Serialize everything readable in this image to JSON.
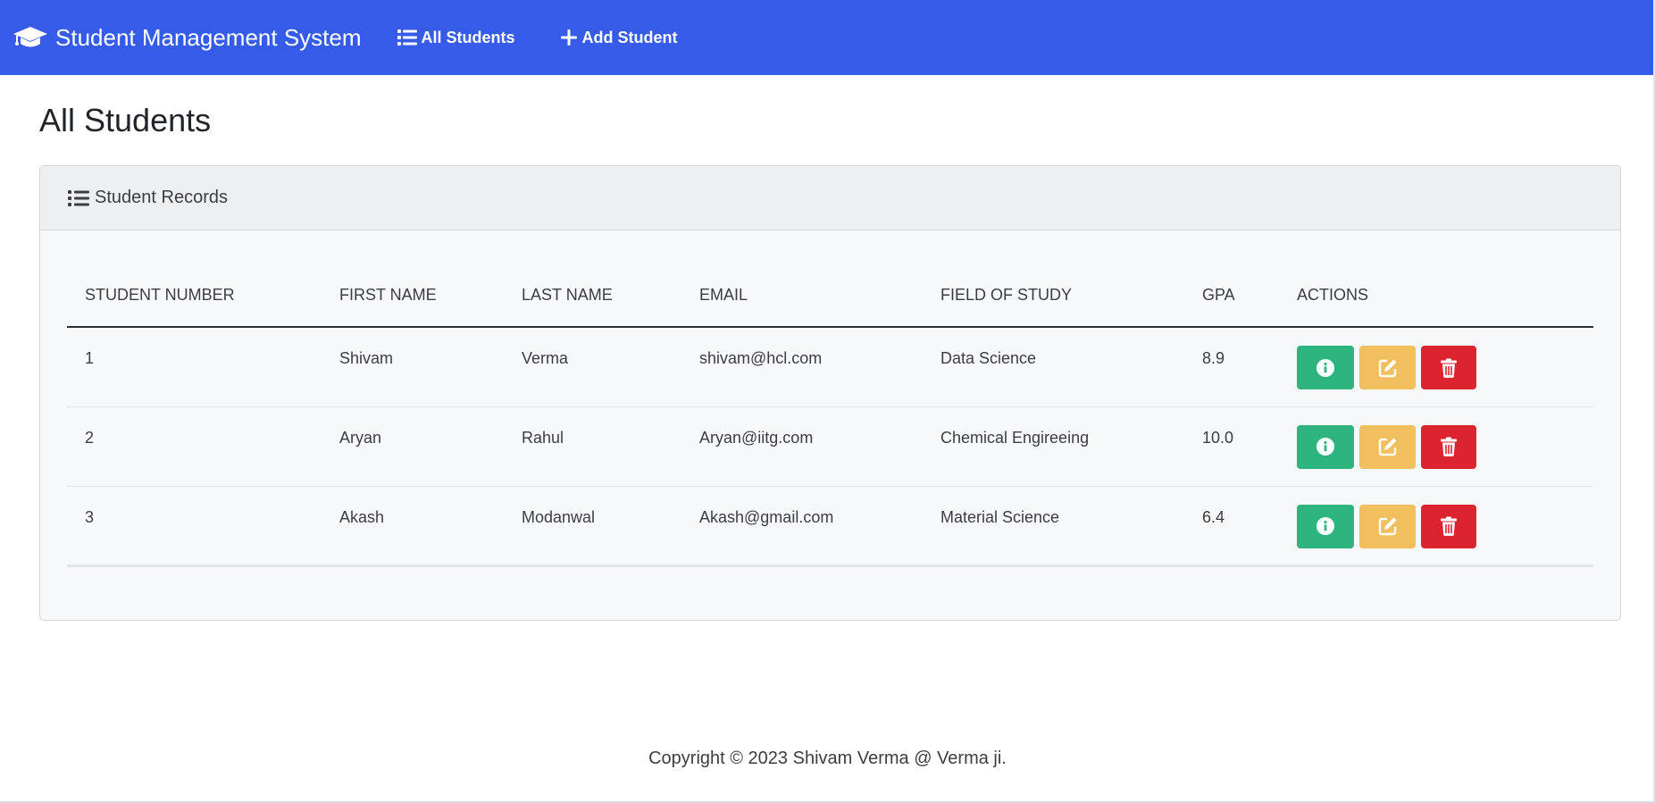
{
  "navbar": {
    "brand": "Student Management System",
    "links": [
      {
        "label": "All Students",
        "icon": "list-icon"
      },
      {
        "label": "Add Student",
        "icon": "plus-icon"
      }
    ],
    "color": "#365be9"
  },
  "page": {
    "title": "All Students"
  },
  "card": {
    "header": "Student Records"
  },
  "table": {
    "columns": [
      "STUDENT NUMBER",
      "FIRST NAME",
      "LAST NAME",
      "EMAIL",
      "FIELD OF STUDY",
      "GPA",
      "ACTIONS"
    ],
    "rows": [
      {
        "number": "1",
        "first": "Shivam",
        "last": "Verma",
        "email": "shivam@hcl.com",
        "field": "Data Science",
        "gpa": "8.9"
      },
      {
        "number": "2",
        "first": "Aryan",
        "last": "Rahul",
        "email": "Aryan@iitg.com",
        "field": "Chemical Engireeing",
        "gpa": "10.0"
      },
      {
        "number": "3",
        "first": "Akash",
        "last": "Modanwal",
        "email": "Akash@gmail.com",
        "field": "Material Science",
        "gpa": "6.4"
      }
    ]
  },
  "actions": {
    "info": {
      "icon": "info-circle-icon",
      "color": "#2db57d"
    },
    "edit": {
      "icon": "edit-icon",
      "color": "#f1bf5e"
    },
    "delete": {
      "icon": "trash-icon",
      "color": "#dc2431"
    }
  },
  "footer": {
    "text": "Copyright © 2023 Shivam Verma @ Verma ji."
  }
}
